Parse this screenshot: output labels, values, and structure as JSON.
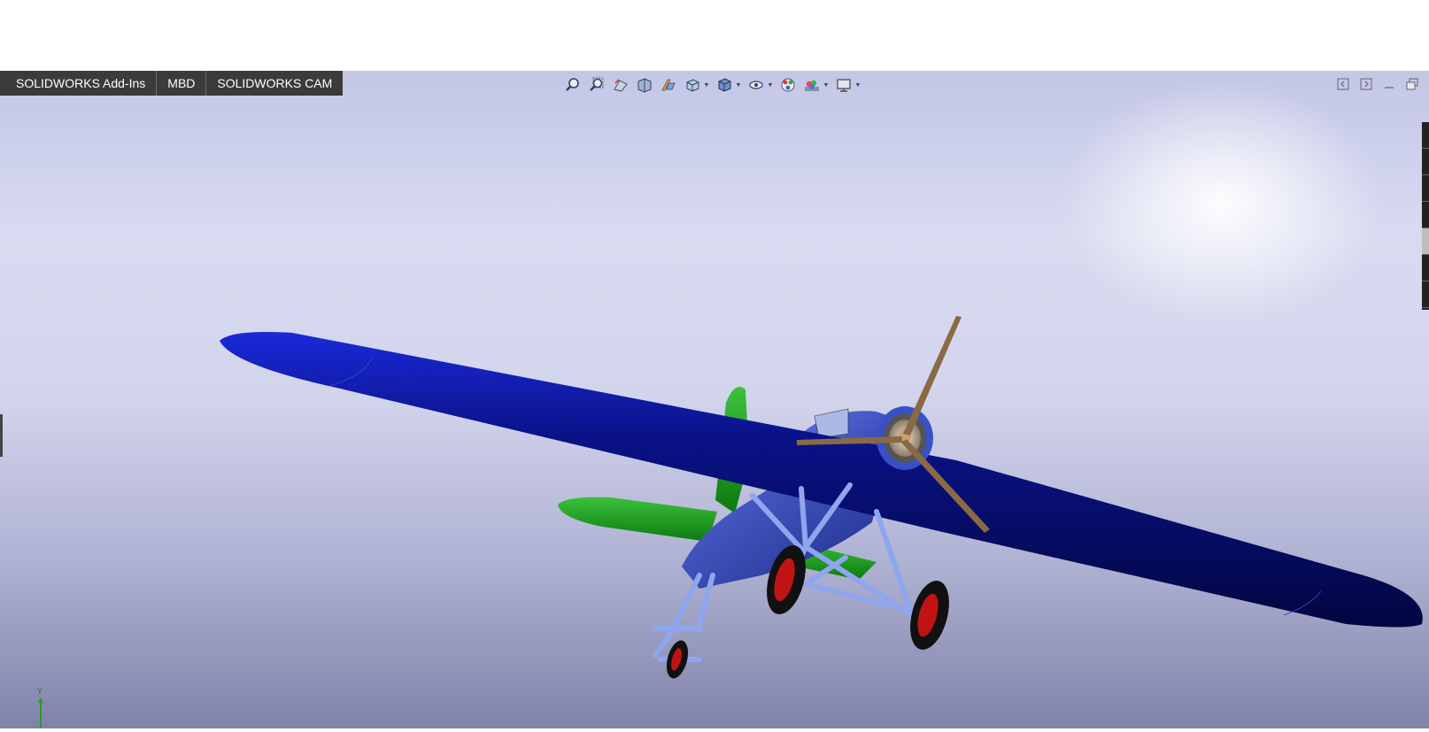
{
  "command_manager": {
    "tabs": [
      {
        "label": "SOLIDWORKS Add-Ins"
      },
      {
        "label": "MBD"
      },
      {
        "label": "SOLIDWORKS CAM"
      }
    ]
  },
  "heads_up_toolbar": {
    "icons": [
      "zoom-to-fit-icon",
      "zoom-to-area-icon",
      "previous-view-icon",
      "section-view-icon",
      "dynamic-annotation-icon",
      "view-orientation-icon",
      "display-style-icon",
      "hide-show-items-icon",
      "edit-appearance-icon",
      "apply-scene-icon",
      "view-settings-icon"
    ]
  },
  "window_controls": {
    "icons": [
      "tile-left-icon",
      "tile-right-icon",
      "minimize-icon",
      "restore-icon"
    ]
  },
  "triad": {
    "y_label": "Y"
  },
  "colors": {
    "wing_blue": "#0a0f8c",
    "fuselage_blue": "#3347b8",
    "tail_green": "#1a9a1a",
    "strut_blue": "#7f9be8",
    "propeller": "#8a6a44",
    "wheel_rim": "#c01414"
  }
}
